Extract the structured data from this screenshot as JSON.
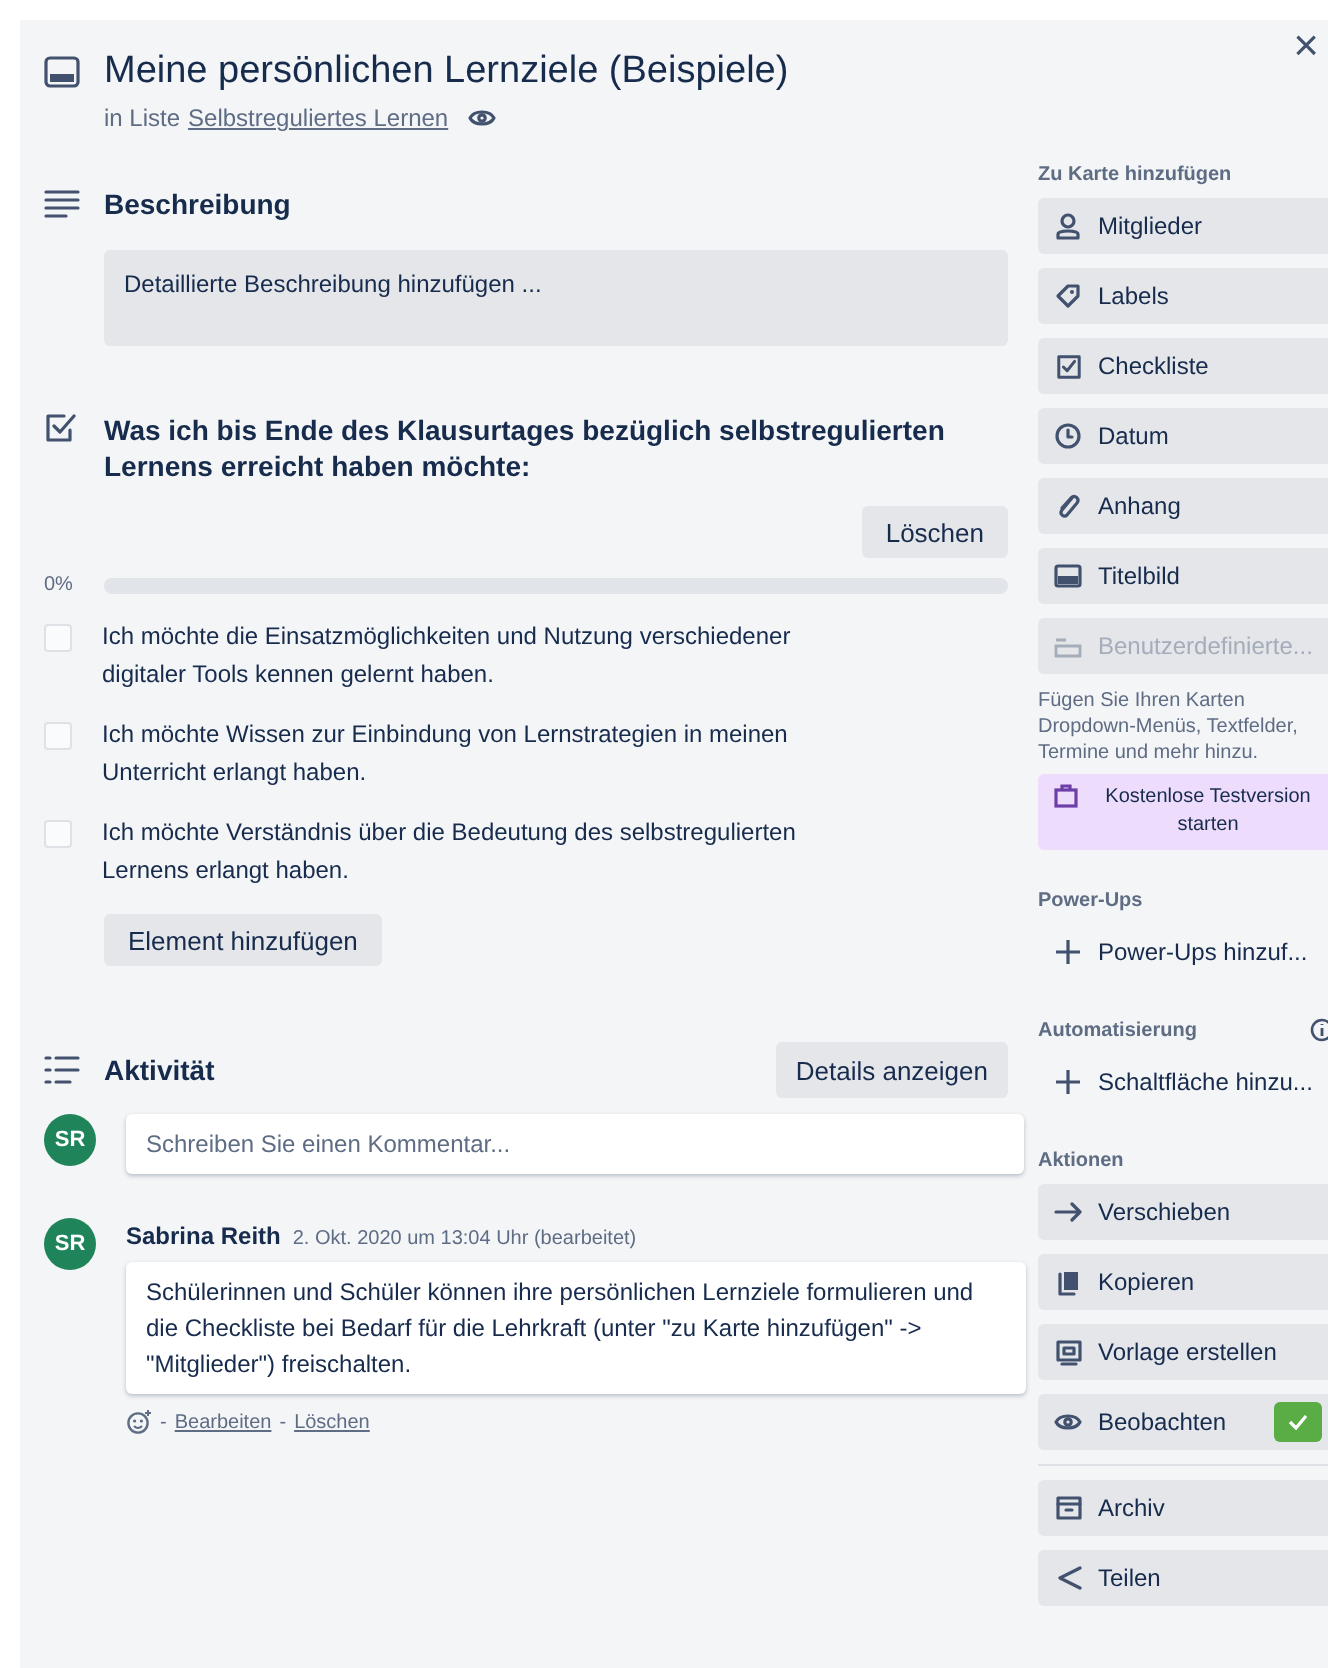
{
  "close": "×",
  "card": {
    "title": "Meine persönlichen Lernziele (Beispiele)",
    "list_prefix": "in Liste",
    "list_name": "Selbstreguliertes Lernen"
  },
  "description": {
    "heading": "Beschreibung",
    "placeholder": "Detaillierte Beschreibung hinzufügen ..."
  },
  "checklist": {
    "title": "Was ich bis Ende des Klausurtages bezüglich selbstregulierten Lernens erreicht haben möchte:",
    "delete_button": "Löschen",
    "progress_label": "0%",
    "level": 0,
    "items": [
      {
        "text": "Ich möchte die Einsatzmöglichkeiten und Nutzung verschiedener digitaler Tools kennen gelernt haben.",
        "checked": false
      },
      {
        "text": "Ich möchte Wissen zur Einbindung von Lernstrategien in meinen Unterricht erlangt haben.",
        "checked": false
      },
      {
        "text": "Ich möchte Verständnis über die Bedeutung des selbstregulierten Lernens erlangt haben.",
        "checked": false
      }
    ],
    "add_button": "Element hinzufügen"
  },
  "activity": {
    "heading": "Aktivität",
    "details_button": "Details anzeigen",
    "avatar": "SR",
    "comment_placeholder": "Schreiben Sie einen Kommentar...",
    "comments": [
      {
        "avatar": "SR",
        "author": "Sabrina Reith",
        "time": "2. Okt. 2020 um 13:04 Uhr (bearbeitet)",
        "text": "Schülerinnen und Schüler können ihre persönlichen Lernziele formulieren und die Checkliste bei Bedarf für die Lehrkraft (unter \"zu Karte hinzufügen\" -> \"Mitglieder\") freischalten.",
        "separator": "-",
        "actions": [
          "Bearbeiten",
          "Löschen"
        ]
      }
    ]
  },
  "sidebar": [
    {
      "heading": "Zu Karte hinzufügen",
      "items": [
        {
          "kind": "button",
          "label": "Mitglieder",
          "disabled": false
        },
        {
          "kind": "button",
          "label": "Labels",
          "disabled": false
        },
        {
          "kind": "button",
          "label": "Checkliste",
          "disabled": false
        },
        {
          "kind": "button",
          "label": "Datum",
          "disabled": false
        },
        {
          "kind": "button",
          "label": "Anhang",
          "disabled": false
        },
        {
          "kind": "button",
          "label": "Titelbild",
          "disabled": false
        },
        {
          "kind": "button",
          "label": "Benutzerdefinierte...",
          "disabled": true
        },
        {
          "kind": "note",
          "text": "Fügen Sie Ihren Karten Dropdown-Menüs, Textfelder, Termine und mehr hinzu."
        },
        {
          "kind": "promo",
          "label": "Kostenlose Testversion starten"
        }
      ]
    },
    {
      "heading": "Power-Ups",
      "items": [
        {
          "kind": "add",
          "label": "Power-Ups hinzuf..."
        }
      ]
    },
    {
      "heading": "Automatisierung",
      "info": true,
      "items": [
        {
          "kind": "add",
          "label": "Schaltfläche hinzu..."
        }
      ]
    },
    {
      "heading": "Aktionen",
      "items": [
        {
          "kind": "button",
          "label": "Verschieben",
          "disabled": false
        },
        {
          "kind": "button",
          "label": "Kopieren",
          "disabled": false
        },
        {
          "kind": "button",
          "label": "Vorlage erstellen",
          "disabled": false
        },
        {
          "kind": "toggle",
          "label": "Beobachten",
          "on": true
        },
        {
          "kind": "divider"
        },
        {
          "kind": "button",
          "label": "Archiv",
          "disabled": false
        },
        {
          "kind": "button",
          "label": "Teilen",
          "disabled": false
        }
      ]
    }
  ]
}
